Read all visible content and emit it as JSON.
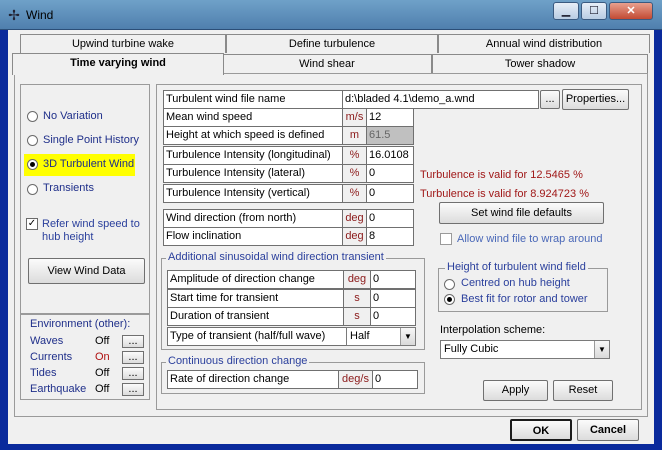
{
  "window": {
    "title": "Wind"
  },
  "tabs_row1": [
    "Upwind turbine wake",
    "Define turbulence",
    "Annual wind distribution"
  ],
  "tabs_row2": [
    "Time varying wind",
    "Wind shear",
    "Tower shadow"
  ],
  "variation_options": [
    "No Variation",
    "Single Point History",
    "3D Turbulent Wind",
    "Transients"
  ],
  "selected_variation": "3D Turbulent Wind",
  "refer_hub": {
    "label_line1": "Refer wind speed to",
    "label_line2": "hub height",
    "checked_mark": "✓"
  },
  "view_wind_data": "View Wind Data",
  "environment": {
    "title": "Environment (other):",
    "items": [
      {
        "label": "Waves",
        "state": "Off",
        "button": "..."
      },
      {
        "label": "Currents",
        "state": "On",
        "button": "..."
      },
      {
        "label": "Tides",
        "state": "Off",
        "button": "..."
      },
      {
        "label": "Earthquake",
        "state": "Off",
        "button": "..."
      }
    ]
  },
  "turbulent_file": {
    "label": "Turbulent wind file name",
    "value": "d:\\bladed 4.1\\demo_a.wnd",
    "browse": "...",
    "properties": "Properties..."
  },
  "main_rows": [
    {
      "label": "Mean wind speed",
      "unit": "m/s",
      "value": "12"
    },
    {
      "label": "Height at which speed is defined",
      "unit": "m",
      "value": "61.5"
    },
    {
      "label": "Turbulence Intensity (longitudinal)",
      "unit": "%",
      "value": "16.0108"
    },
    {
      "label": "Turbulence Intensity (lateral)",
      "unit": "%",
      "value": "0"
    },
    {
      "label": "Turbulence Intensity (vertical)",
      "unit": "%",
      "value": "0"
    }
  ],
  "warnings": [
    "Turbulence is valid for  12.5465 %",
    "Turbulence is valid for  8.924723 %"
  ],
  "direction_rows": [
    {
      "label": "Wind direction (from north)",
      "unit": "deg",
      "value": "0"
    },
    {
      "label": "Flow inclination",
      "unit": "deg",
      "value": "8"
    }
  ],
  "set_defaults": "Set wind file defaults",
  "allow_wrap": "Allow wind file to wrap around",
  "transient": {
    "title": "Additional sinusoidal wind direction transient",
    "rows": [
      {
        "label": "Amplitude of direction change",
        "unit": "deg",
        "value": "0"
      },
      {
        "label": "Start time for transient",
        "unit": "s",
        "value": "0"
      },
      {
        "label": "Duration of transient",
        "unit": "s",
        "value": "0"
      }
    ],
    "type_label": "Type of transient (half/full wave)",
    "type_value": "Half"
  },
  "continuous": {
    "title": "Continuous direction change",
    "label": "Rate of direction change",
    "unit": "deg/s",
    "value": "0"
  },
  "height_group": {
    "title": "Height of turbulent wind field",
    "options": [
      "Centred on hub height",
      "Best fit for rotor and tower"
    ],
    "selected": "Best fit for rotor and tower"
  },
  "interpolation": {
    "label": "Interpolation scheme:",
    "value": "Fully Cubic"
  },
  "buttons": {
    "apply": "Apply",
    "reset": "Reset",
    "ok": "OK",
    "cancel": "Cancel"
  },
  "colors": {
    "frame": "#0a2a9c",
    "highlight": "#ffff00",
    "warning": "#a01818"
  }
}
